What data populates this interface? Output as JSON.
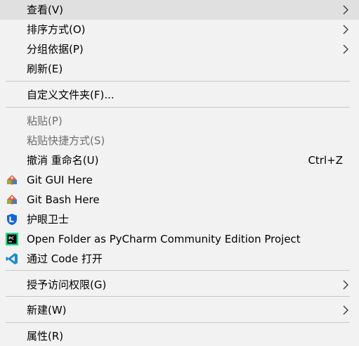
{
  "menu": {
    "view": {
      "label": "查看(V)"
    },
    "sort": {
      "label": "排序方式(O)"
    },
    "group": {
      "label": "分组依据(P)"
    },
    "refresh": {
      "label": "刷新(E)"
    },
    "customize": {
      "label": "自定义文件夹(F)..."
    },
    "paste": {
      "label": "粘贴(P)"
    },
    "paste_shortcut": {
      "label": "粘贴快捷方式(S)"
    },
    "undo": {
      "label": "撤消 重命名(U)",
      "shortcut": "Ctrl+Z"
    },
    "git_gui": {
      "label": "Git GUI Here",
      "icon": "git-gui-icon"
    },
    "git_bash": {
      "label": "Git Bash Here",
      "icon": "git-bash-icon"
    },
    "eye_guard": {
      "label": "护眼卫士",
      "icon": "eye-guard-icon"
    },
    "pycharm": {
      "label": "Open Folder as PyCharm Community Edition Project",
      "icon": "pycharm-icon"
    },
    "vscode": {
      "label": "通过 Code 打开",
      "icon": "vscode-icon"
    },
    "grant_access": {
      "label": "授予访问权限(G)"
    },
    "new": {
      "label": "新建(W)"
    },
    "properties": {
      "label": "属性(R)"
    }
  },
  "colors": {
    "background": "#f2f2f2",
    "text": "#000000",
    "disabled_text": "#6d6d6d",
    "separator": "#c8c8c8",
    "vscode_blue": "#1f8ad2",
    "guard_blue": "#1565d8",
    "git_red": "#e8573b"
  }
}
